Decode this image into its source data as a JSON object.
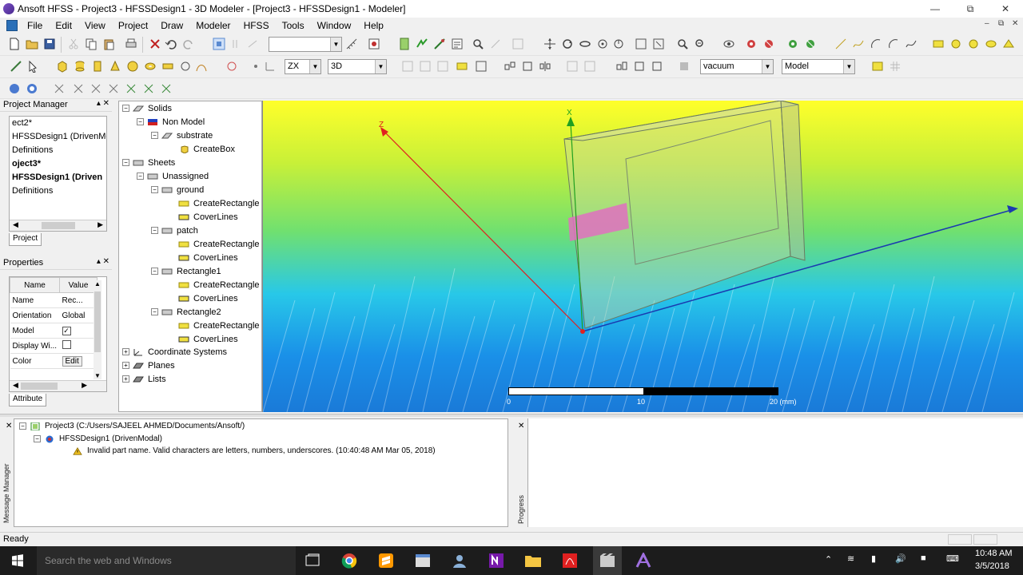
{
  "window": {
    "title": "Ansoft HFSS - Project3 - HFSSDesign1 - 3D Modeler - [Project3 - HFSSDesign1 - Modeler]",
    "controls": [
      "—",
      "⧉",
      "✕"
    ]
  },
  "menu": [
    "File",
    "Edit",
    "View",
    "Project",
    "Draw",
    "Modeler",
    "HFSS",
    "Tools",
    "Window",
    "Help"
  ],
  "toolbar": {
    "plane_combo": "ZX",
    "view_combo": "3D",
    "material_combo": "vacuum",
    "model_combo": "Model",
    "blank_combo": ""
  },
  "project_manager": {
    "title": "Project Manager",
    "items": [
      "ect2*",
      "HFSSDesign1 (DrivenMod",
      "Definitions",
      "oject3*",
      "HFSSDesign1 (Driven",
      "Definitions"
    ],
    "tab": "Project"
  },
  "properties": {
    "title": "Properties",
    "headers": [
      "Name",
      "Value"
    ],
    "rows": [
      {
        "name": "Name",
        "value": "Rec..."
      },
      {
        "name": "Orientation",
        "value": "Global"
      },
      {
        "name": "Model",
        "value": "✓"
      },
      {
        "name": "Display Wi...",
        "value": ""
      },
      {
        "name": "Color",
        "value": "Edit"
      }
    ],
    "tab": "Attribute"
  },
  "tree": {
    "solids": "Solids",
    "non_model": "Non Model",
    "substrate": "substrate",
    "create_box": "CreateBox",
    "sheets": "Sheets",
    "unassigned": "Unassigned",
    "ground": "ground",
    "patch": "patch",
    "rect1": "Rectangle1",
    "rect2": "Rectangle2",
    "create_rect": "CreateRectangle",
    "cover_lines": "CoverLines",
    "coord": "Coordinate Systems",
    "planes": "Planes",
    "lists": "Lists"
  },
  "viewport": {
    "axis_z": "Z",
    "axis_x": "X",
    "scale_labels": [
      "0",
      "10",
      "20 (mm)"
    ]
  },
  "messages": {
    "label": "Message Manager",
    "project": "Project3 (C:/Users/SAJEEL AHMED/Documents/Ansoft/)",
    "design": "HFSSDesign1 (DrivenModal)",
    "warning": "Invalid part name. Valid characters are letters, numbers, underscores. (10:40:48 AM  Mar 05, 2018)"
  },
  "progress": {
    "label": "Progress"
  },
  "status": {
    "text": "Ready"
  },
  "taskbar": {
    "search": "Search the web and Windows",
    "time": "10:48 AM",
    "date": "3/5/2018"
  }
}
